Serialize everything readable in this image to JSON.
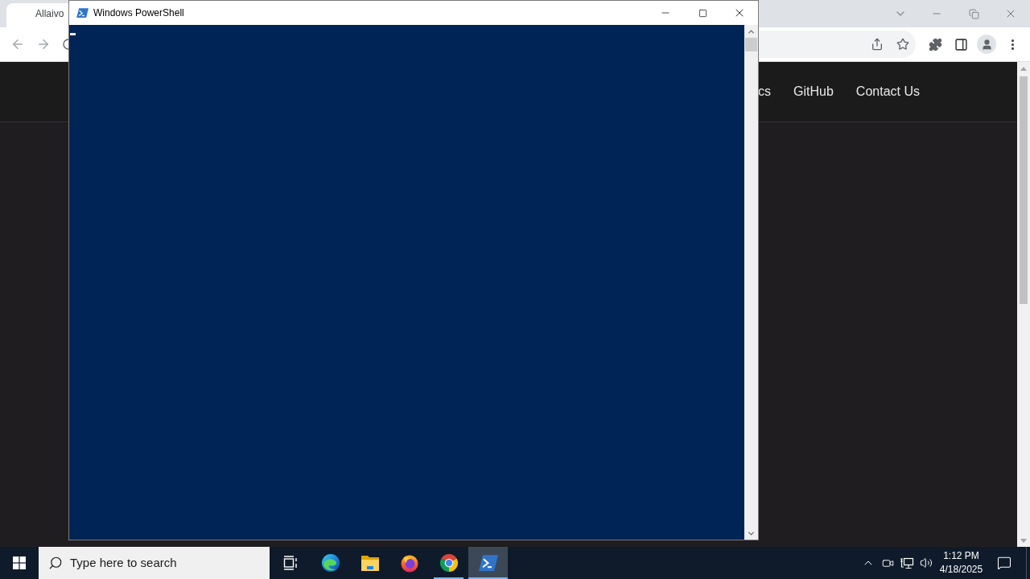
{
  "browser": {
    "tab": {
      "title": "Allaivo",
      "selected": true
    },
    "nav_links": [
      "cs",
      "GitHub",
      "Contact Us"
    ]
  },
  "powershell": {
    "title": "Windows PowerShell"
  },
  "taskbar": {
    "search": {
      "placeholder": "Type here to search"
    },
    "apps": [
      {
        "kind": "task_view",
        "running": false,
        "active": false
      },
      {
        "kind": "edge",
        "running": false,
        "active": false
      },
      {
        "kind": "files",
        "running": false,
        "active": false
      },
      {
        "kind": "firefox",
        "running": false,
        "active": false
      },
      {
        "kind": "chrome",
        "running": true,
        "active": false
      },
      {
        "kind": "powershell",
        "running": true,
        "active": true
      }
    ],
    "clock": {
      "time": "1:12 PM",
      "date": "4/18/2025"
    }
  }
}
